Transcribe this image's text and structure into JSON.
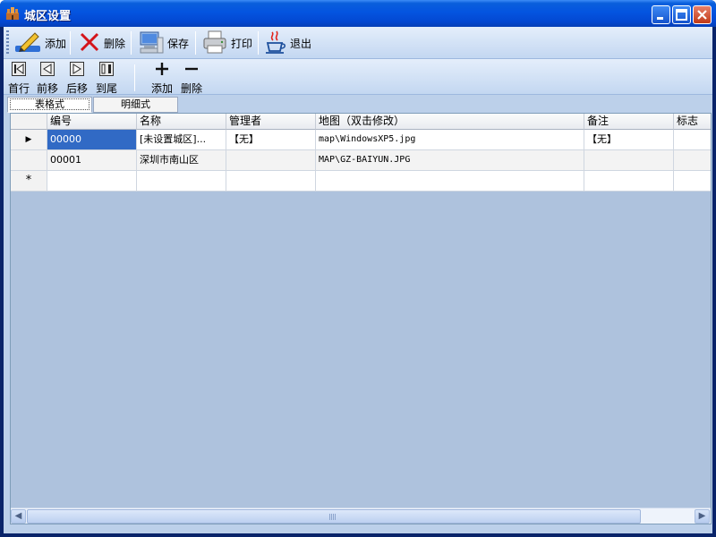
{
  "window": {
    "title": "城区设置"
  },
  "toolbar": {
    "add_label": "添加",
    "delete_label": "删除",
    "save_label": "保存",
    "print_label": "打印",
    "exit_label": "退出"
  },
  "navbar": {
    "first_label": "首行",
    "prev_label": "前移",
    "next_label": "后移",
    "last_label": "到尾",
    "add_label": "添加",
    "delete_label": "删除"
  },
  "tabs": [
    {
      "label": "表格式",
      "active": true
    },
    {
      "label": "明细式",
      "active": false
    }
  ],
  "grid": {
    "columns": [
      "编号",
      "名称",
      "管理者",
      "地图（双击修改）",
      "备注",
      "标志"
    ],
    "rows": [
      {
        "marker": "▶",
        "cells": [
          "00000",
          "[未设置城区]...",
          "【无】",
          "map\\WindowsXP5.jpg",
          "【无】",
          ""
        ]
      },
      {
        "marker": "",
        "cells": [
          "00001",
          "深圳市南山区",
          "",
          "MAP\\GZ-BAIYUN.JPG",
          "",
          ""
        ]
      },
      {
        "marker": "*",
        "cells": [
          "",
          "",
          "",
          "",
          "",
          ""
        ]
      }
    ]
  },
  "colors": {
    "selection": "#316ac5",
    "titlebar": "#0454e0"
  }
}
